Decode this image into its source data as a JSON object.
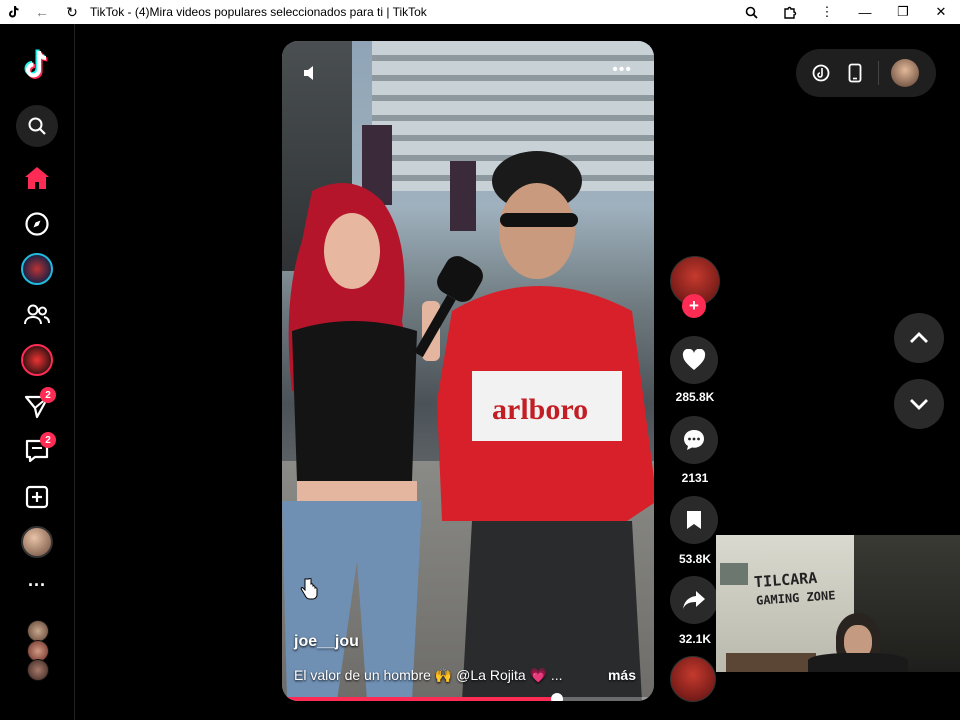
{
  "window": {
    "title": "TikTok - (4)Mira videos populares seleccionados para ti | TikTok"
  },
  "sidebar": {
    "messages_badge": "2",
    "inbox_badge": "2",
    "more_label": "···"
  },
  "video": {
    "username": "joe__jou",
    "caption": "El valor de un hombre 🙌 @La Rojita 💗 ...",
    "more_label": "más",
    "progress": 0.74
  },
  "actions": {
    "likes": "285.8K",
    "comments": "2131",
    "saves": "53.8K",
    "shares": "32.1K"
  },
  "webcam": {
    "sign_line1": "TILCARA",
    "sign_line2": "GAMING ZONE"
  },
  "colors": {
    "accent": "#fe2c55",
    "background": "#000000"
  }
}
